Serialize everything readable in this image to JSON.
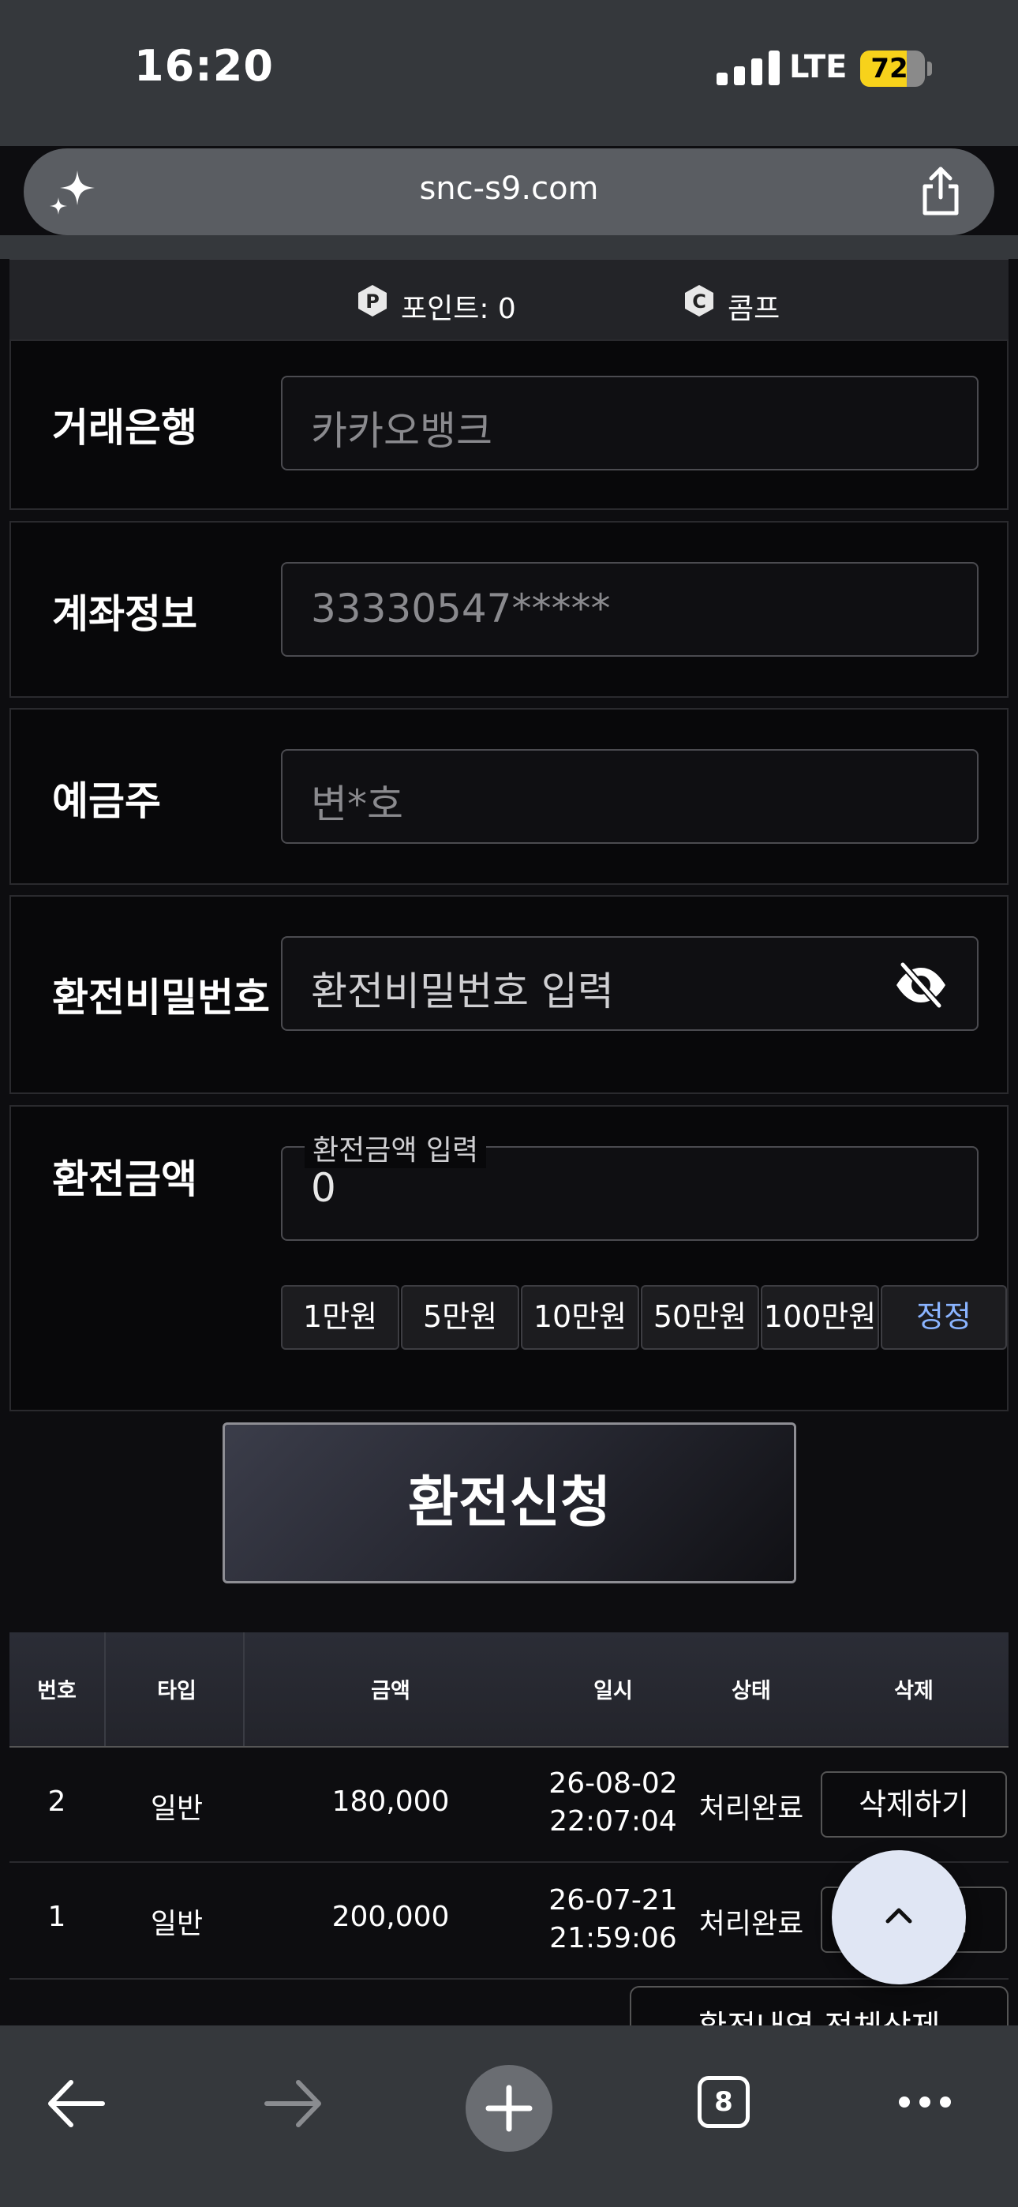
{
  "status": {
    "time": "16:20",
    "network": "LTE",
    "battery": "72",
    "battery_level": 0.72
  },
  "browser": {
    "url": "snc-s9.com",
    "tab_count": "8"
  },
  "points_bar": {
    "points_label": "포인트: 0",
    "comp_label": "콤프"
  },
  "form": {
    "bank": {
      "label": "거래은행",
      "value": "카카오뱅크"
    },
    "account": {
      "label": "계좌정보",
      "value": "33330547*****"
    },
    "holder": {
      "label": "예금주",
      "value": "변*호"
    },
    "password": {
      "label": "환전비밀번호",
      "placeholder": "환전비밀번호 입력"
    },
    "amount": {
      "label": "환전금액",
      "legend": "환전금액 입력",
      "value": "0",
      "quick_buttons": [
        "1만원",
        "5만원",
        "10만원",
        "50만원",
        "100만원"
      ],
      "reset_label": "정정"
    },
    "submit_label": "환전신청"
  },
  "history": {
    "headers": [
      "번호",
      "타입",
      "금액",
      "일시",
      "상태",
      "삭제"
    ],
    "rows": [
      {
        "no": "2",
        "type": "일반",
        "amount": "180,000",
        "date": "26-08-02",
        "time": "22:07:04",
        "status": "처리완료",
        "action": "삭제하기"
      },
      {
        "no": "1",
        "type": "일반",
        "amount": "200,000",
        "date": "26-07-21",
        "time": "21:59:06",
        "status": "처리완료",
        "action": "삭제하기"
      }
    ],
    "delete_all_label": "환전내역 전체삭제"
  }
}
